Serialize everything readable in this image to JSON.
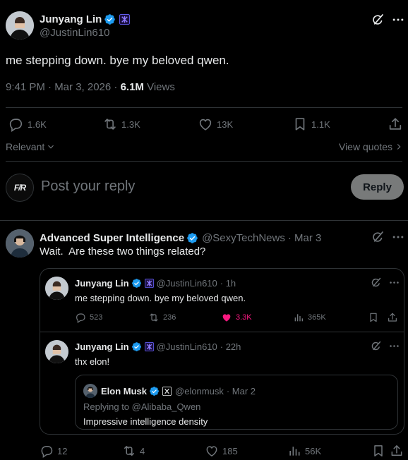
{
  "post": {
    "author_name": "Junyang Lin",
    "author_handle": "@JustinLin610",
    "text": "me stepping down. bye my beloved qwen.",
    "time": "9:41 PM · Mar 3, 2026 · ",
    "views_count": "6.1M",
    "views_label": "Views",
    "stats": {
      "replies": "1.6K",
      "reposts": "1.3K",
      "likes": "13K",
      "bookmarks": "1.1K"
    }
  },
  "filters": {
    "sort_label": "Relevant",
    "view_quotes_label": "View quotes"
  },
  "composer": {
    "placeholder": "Post your reply",
    "reply_button": "Reply"
  },
  "reply": {
    "author_name": "Advanced Super Intelligence",
    "author_handle": "@SexyTechNews",
    "date": "· Mar 3",
    "text": "Wait.  Are these two things related?",
    "stats": {
      "replies": "12",
      "reposts": "4",
      "likes": "185",
      "views": "56K"
    },
    "quote1": {
      "author_name": "Junyang Lin",
      "author_handle": "@JustinLin610",
      "date": "· 1h",
      "text": "me stepping down. bye my beloved qwen.",
      "stats": {
        "replies": "523",
        "reposts": "236",
        "likes": "3.3K",
        "views": "365K"
      }
    },
    "quote2": {
      "author_name": "Junyang Lin",
      "author_handle": "@JustinLin610",
      "date": "· 22h",
      "text": "thx elon!",
      "nested": {
        "author_name": "Elon Musk",
        "author_handle": "@elonmusk",
        "date": "· Mar 2",
        "replying_to": "Replying to @Alibaba_Qwen",
        "text": "Impressive intelligence density"
      }
    }
  },
  "colors": {
    "background": "#000000",
    "text": "#e7e9ea",
    "muted": "#71767b",
    "verified": "#1d9bf0",
    "liked": "#f91880",
    "divider": "#2f3336"
  },
  "icons": [
    "grok-icon",
    "more-icon",
    "reply-icon",
    "repost-icon",
    "like-icon",
    "bookmark-icon",
    "share-icon",
    "views-icon",
    "verified-icon",
    "org-badge-icon",
    "x-badge-icon"
  ]
}
